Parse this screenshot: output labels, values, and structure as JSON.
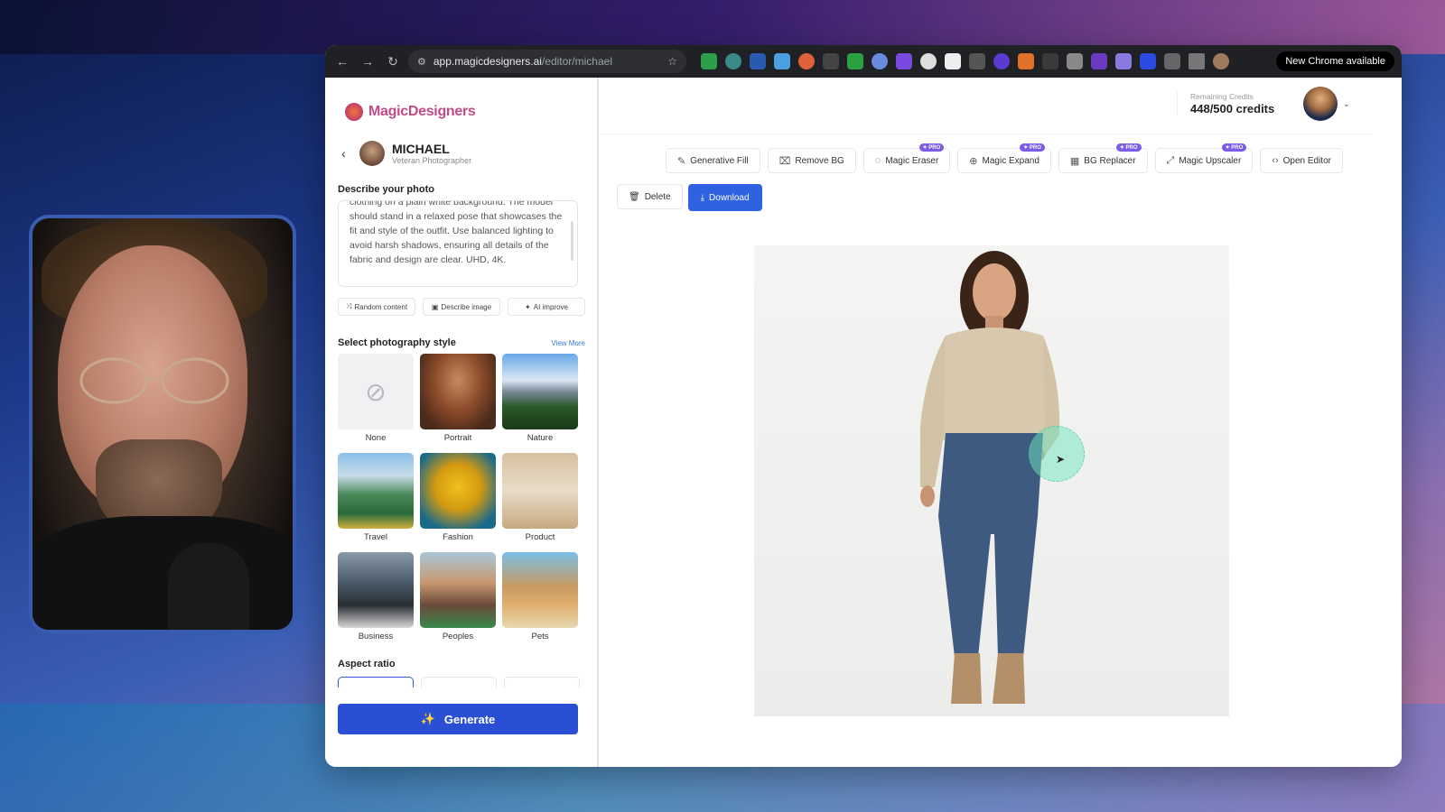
{
  "browser": {
    "url_host": "app.magicdesigners.ai",
    "url_path": "/editor/michael",
    "new_chrome": "New Chrome available",
    "back_icon": "←",
    "forward_icon": "→",
    "reload_icon": "↻",
    "star_icon": "☆"
  },
  "sidebar": {
    "brand": "MagicDesigners",
    "user_name": "MICHAEL",
    "user_role": "Veteran Photographer",
    "describe_title": "Describe your photo",
    "prompt_text": "clothing on a plain white background. The model should stand in a relaxed pose that showcases the fit and style of the outfit. Use balanced lighting to avoid harsh shadows, ensuring all details of the fabric and design are clear. UHD, 4K.",
    "chips": [
      "Random content",
      "Describe image",
      "AI improve"
    ],
    "style_title": "Select photography style",
    "view_more": "View More",
    "styles": [
      "None",
      "Portrait",
      "Nature",
      "Travel",
      "Fashion",
      "Product",
      "Business",
      "Peoples",
      "Pets"
    ],
    "aspect_title": "Aspect ratio",
    "generate_label": "Generate"
  },
  "header": {
    "credits_label": "Remaining Credits",
    "credits_value": "448/500 credits"
  },
  "tools": [
    {
      "label": "Generative Fill",
      "pro": false
    },
    {
      "label": "Remove BG",
      "pro": false
    },
    {
      "label": "Magic Eraser",
      "pro": true
    },
    {
      "label": "Magic Expand",
      "pro": true
    },
    {
      "label": "BG Replacer",
      "pro": true
    },
    {
      "label": "Magic Upscaler",
      "pro": true
    },
    {
      "label": "Open Editor",
      "pro": false
    }
  ],
  "pro_badge": "✦ PRO",
  "actions": {
    "delete_label": "Delete",
    "download_label": "Download"
  },
  "colors": {
    "accent": "#2b4fd4",
    "download": "#2f62e0",
    "brand": "#c04a8a",
    "pro": "#7b5ce6",
    "brush": "#6ee6be"
  }
}
